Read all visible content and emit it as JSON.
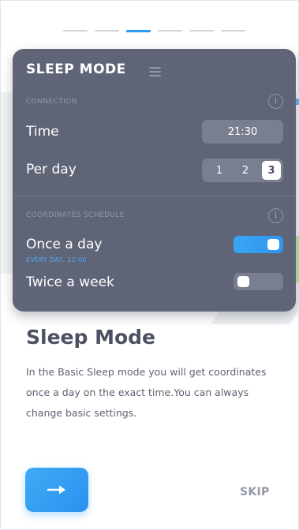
{
  "pager": {
    "total": 6,
    "active_index": 2
  },
  "card": {
    "title": "SLEEP MODE",
    "menu_icon": "hamburger-icon",
    "connection": {
      "label": "CONNECTION",
      "info_icon": "info-icon",
      "time_label": "Time",
      "time_value": "21:30",
      "per_day_label": "Per day",
      "per_day_options": [
        "1",
        "2",
        "3"
      ],
      "per_day_selected": "3"
    },
    "schedule": {
      "label": "COORDINATES SCHEDULE",
      "info_icon": "info-icon",
      "once_label": "Once a day",
      "once_on": true,
      "once_caption": "EVERY DAY, 12:00",
      "twice_label": "Twice a week",
      "twice_on": false
    }
  },
  "content": {
    "heading": "Sleep Mode",
    "body": "In the Basic Sleep mode you will get coordinates once a day on the exact time.You can always change basic settings."
  },
  "actions": {
    "next_icon": "arrow-right-icon",
    "skip_label": "SKIP"
  },
  "colors": {
    "accent": "#2f9df4",
    "card_bg": "#5f6577",
    "pill_bg": "#797f90",
    "heading": "#4b5163"
  }
}
